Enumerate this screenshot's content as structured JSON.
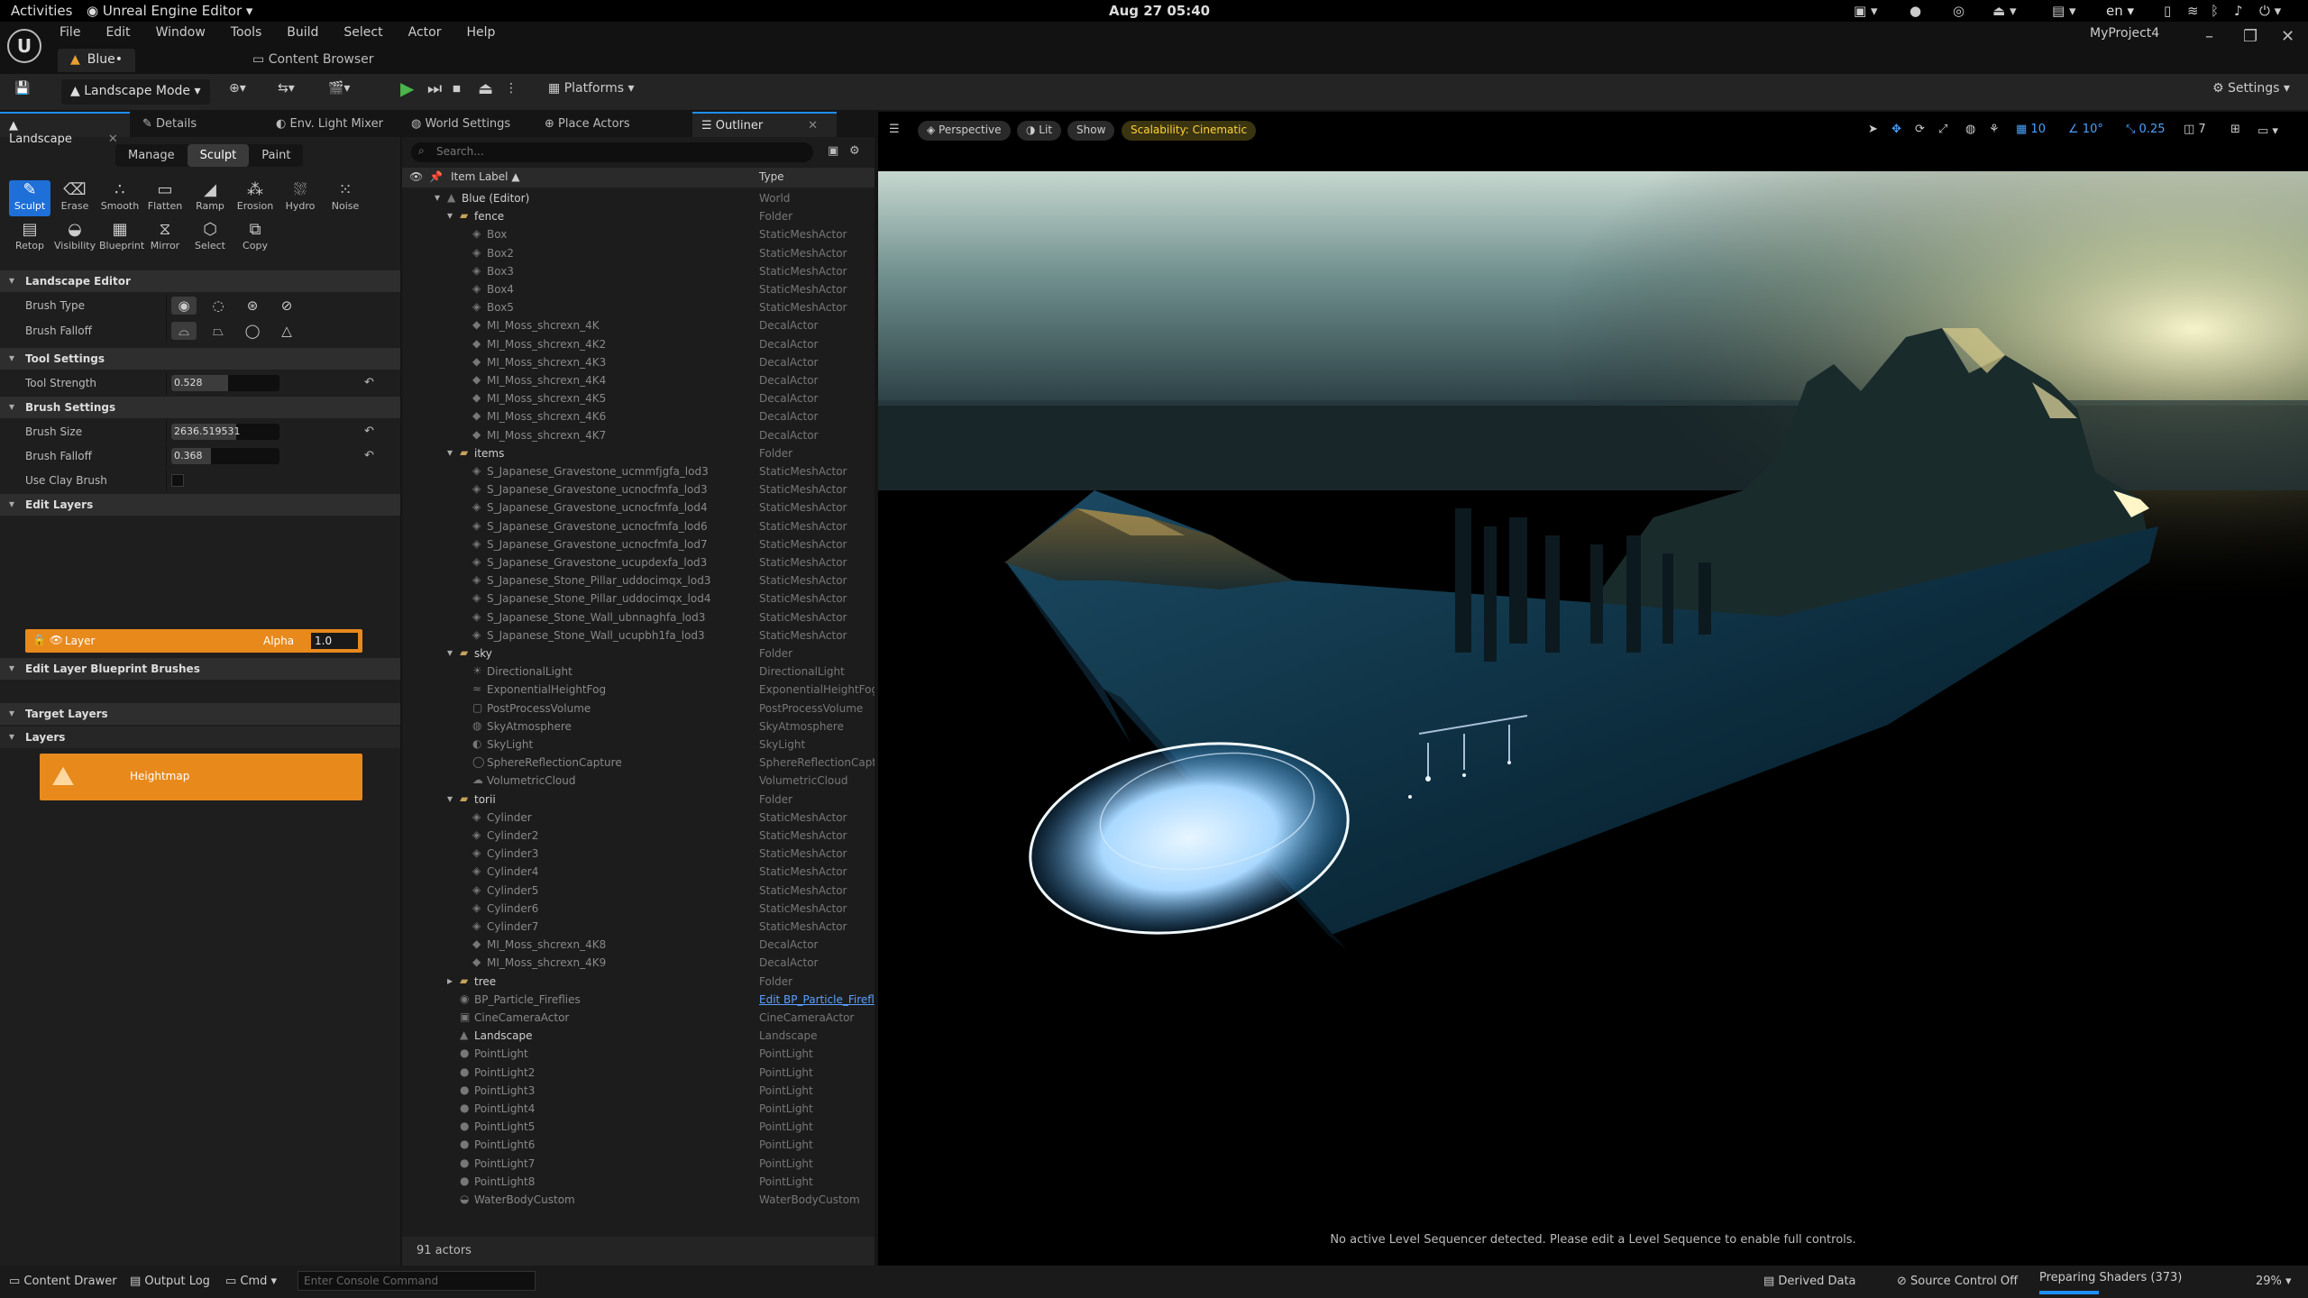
{
  "system_bar": {
    "activities": "Activities",
    "app_name": "Unreal Engine Editor",
    "clock": "Aug 27  05:40",
    "language": "en"
  },
  "editor": {
    "menu": [
      "File",
      "Edit",
      "Window",
      "Tools",
      "Build",
      "Select",
      "Actor",
      "Help"
    ],
    "project": "MyProject4",
    "level_tab": "Blue•",
    "content_browser_tab": "Content Browser"
  },
  "toolbar": {
    "mode": "Landscape Mode",
    "platforms": "Platforms",
    "settings": "Settings"
  },
  "left_panel": {
    "tabs": [
      "Landscape",
      "Details",
      "Env. Light Mixer"
    ],
    "modes": [
      "Manage",
      "Sculpt",
      "Paint"
    ],
    "tools_row1": [
      "Sculpt",
      "Erase",
      "Smooth",
      "Flatten",
      "Ramp",
      "Erosion",
      "Hydro",
      "Noise"
    ],
    "tools_row2": [
      "Retop",
      "Visibility",
      "Blueprint",
      "Mirror",
      "Select",
      "Copy"
    ],
    "sections": {
      "landscape_editor": "Landscape Editor",
      "tool_settings": "Tool Settings",
      "brush_settings": "Brush Settings",
      "edit_layers": "Edit Layers",
      "edit_layer_bp": "Edit Layer Blueprint Brushes",
      "target_layers": "Target Layers",
      "layers": "Layers"
    },
    "brush_type_label": "Brush Type",
    "brush_falloff_type_label": "Brush Falloff",
    "tool_strength_label": "Tool Strength",
    "tool_strength": "0.528",
    "tool_strength_fraction": 0.528,
    "brush_size_label": "Brush Size",
    "brush_size": "2636.519531",
    "brush_size_fraction": 0.6,
    "brush_falloff_label": "Brush Falloff",
    "brush_falloff": "0.368",
    "brush_falloff_fraction": 0.368,
    "use_clay_brush_label": "Use Clay Brush",
    "layer_name": "Layer",
    "alpha_label": "Alpha",
    "alpha_value": "1.0",
    "heightmap": "Heightmap"
  },
  "outliner": {
    "tabs": [
      "World Settings",
      "Place Actors",
      "Outliner"
    ],
    "search_placeholder": "Search...",
    "col_label": "Item Label ▲",
    "col_type": "Type",
    "rows": [
      {
        "name": "Blue (Editor)",
        "type": "World",
        "level": 0,
        "icon": "world-icon",
        "caret": "▾",
        "bright": true
      },
      {
        "name": "fence",
        "type": "Folder",
        "level": 1,
        "icon": "folder-icon",
        "caret": "▾",
        "bright": true
      },
      {
        "name": "Box",
        "type": "StaticMeshActor",
        "level": 2,
        "icon": "mesh-icon"
      },
      {
        "name": "Box2",
        "type": "StaticMeshActor",
        "level": 2,
        "icon": "mesh-icon"
      },
      {
        "name": "Box3",
        "type": "StaticMeshActor",
        "level": 2,
        "icon": "mesh-icon"
      },
      {
        "name": "Box4",
        "type": "StaticMeshActor",
        "level": 2,
        "icon": "mesh-icon"
      },
      {
        "name": "Box5",
        "type": "StaticMeshActor",
        "level": 2,
        "icon": "mesh-icon"
      },
      {
        "name": "MI_Moss_shcrexn_4K",
        "type": "DecalActor",
        "level": 2,
        "icon": "decal-icon"
      },
      {
        "name": "MI_Moss_shcrexn_4K2",
        "type": "DecalActor",
        "level": 2,
        "icon": "decal-icon"
      },
      {
        "name": "MI_Moss_shcrexn_4K3",
        "type": "DecalActor",
        "level": 2,
        "icon": "decal-icon"
      },
      {
        "name": "MI_Moss_shcrexn_4K4",
        "type": "DecalActor",
        "level": 2,
        "icon": "decal-icon"
      },
      {
        "name": "MI_Moss_shcrexn_4K5",
        "type": "DecalActor",
        "level": 2,
        "icon": "decal-icon"
      },
      {
        "name": "MI_Moss_shcrexn_4K6",
        "type": "DecalActor",
        "level": 2,
        "icon": "decal-icon"
      },
      {
        "name": "MI_Moss_shcrexn_4K7",
        "type": "DecalActor",
        "level": 2,
        "icon": "decal-icon"
      },
      {
        "name": "items",
        "type": "Folder",
        "level": 1,
        "icon": "folder-icon",
        "caret": "▾",
        "bright": true
      },
      {
        "name": "S_Japanese_Gravestone_ucmmfjgfa_lod3",
        "type": "StaticMeshActor",
        "level": 2,
        "icon": "mesh-icon"
      },
      {
        "name": "S_Japanese_Gravestone_ucnocfmfa_lod3",
        "type": "StaticMeshActor",
        "level": 2,
        "icon": "mesh-icon"
      },
      {
        "name": "S_Japanese_Gravestone_ucnocfmfa_lod4",
        "type": "StaticMeshActor",
        "level": 2,
        "icon": "mesh-icon"
      },
      {
        "name": "S_Japanese_Gravestone_ucnocfmfa_lod6",
        "type": "StaticMeshActor",
        "level": 2,
        "icon": "mesh-icon"
      },
      {
        "name": "S_Japanese_Gravestone_ucnocfmfa_lod7",
        "type": "StaticMeshActor",
        "level": 2,
        "icon": "mesh-icon"
      },
      {
        "name": "S_Japanese_Gravestone_ucupdexfa_lod3",
        "type": "StaticMeshActor",
        "level": 2,
        "icon": "mesh-icon"
      },
      {
        "name": "S_Japanese_Stone_Pillar_uddocimqx_lod3",
        "type": "StaticMeshActor",
        "level": 2,
        "icon": "mesh-icon"
      },
      {
        "name": "S_Japanese_Stone_Pillar_uddocimqx_lod4",
        "type": "StaticMeshActor",
        "level": 2,
        "icon": "mesh-icon"
      },
      {
        "name": "S_Japanese_Stone_Wall_ubnnaghfa_lod3",
        "type": "StaticMeshActor",
        "level": 2,
        "icon": "mesh-icon"
      },
      {
        "name": "S_Japanese_Stone_Wall_ucupbh1fa_lod3",
        "type": "StaticMeshActor",
        "level": 2,
        "icon": "mesh-icon"
      },
      {
        "name": "sky",
        "type": "Folder",
        "level": 1,
        "icon": "folder-icon",
        "caret": "▾",
        "bright": true
      },
      {
        "name": "DirectionalLight",
        "type": "DirectionalLight",
        "level": 2,
        "icon": "sun-icon"
      },
      {
        "name": "ExponentialHeightFog",
        "type": "ExponentialHeightFog",
        "level": 2,
        "icon": "fog-icon"
      },
      {
        "name": "PostProcessVolume",
        "type": "PostProcessVolume",
        "level": 2,
        "icon": "volume-icon"
      },
      {
        "name": "SkyAtmosphere",
        "type": "SkyAtmosphere",
        "level": 2,
        "icon": "sky-icon"
      },
      {
        "name": "SkyLight",
        "type": "SkyLight",
        "level": 2,
        "icon": "skylight-icon"
      },
      {
        "name": "SphereReflectionCapture",
        "type": "SphereReflectionCapture",
        "level": 2,
        "icon": "sphere-icon"
      },
      {
        "name": "VolumetricCloud",
        "type": "VolumetricCloud",
        "level": 2,
        "icon": "cloud-icon"
      },
      {
        "name": "torii",
        "type": "Folder",
        "level": 1,
        "icon": "folder-icon",
        "caret": "▾",
        "bright": true
      },
      {
        "name": "Cylinder",
        "type": "StaticMeshActor",
        "level": 2,
        "icon": "mesh-icon"
      },
      {
        "name": "Cylinder2",
        "type": "StaticMeshActor",
        "level": 2,
        "icon": "mesh-icon"
      },
      {
        "name": "Cylinder3",
        "type": "StaticMeshActor",
        "level": 2,
        "icon": "mesh-icon"
      },
      {
        "name": "Cylinder4",
        "type": "StaticMeshActor",
        "level": 2,
        "icon": "mesh-icon"
      },
      {
        "name": "Cylinder5",
        "type": "StaticMeshActor",
        "level": 2,
        "icon": "mesh-icon"
      },
      {
        "name": "Cylinder6",
        "type": "StaticMeshActor",
        "level": 2,
        "icon": "mesh-icon"
      },
      {
        "name": "Cylinder7",
        "type": "StaticMeshActor",
        "level": 2,
        "icon": "mesh-icon"
      },
      {
        "name": "MI_Moss_shcrexn_4K8",
        "type": "DecalActor",
        "level": 2,
        "icon": "decal-icon"
      },
      {
        "name": "MI_Moss_shcrexn_4K9",
        "type": "DecalActor",
        "level": 2,
        "icon": "decal-icon"
      },
      {
        "name": "tree",
        "type": "Folder",
        "level": 1,
        "icon": "folder-icon",
        "caret": "▸",
        "bright": true
      },
      {
        "name": "BP_Particle_Fireflies",
        "type": "Edit BP_Particle_Firefl",
        "level": 1,
        "icon": "blueprint-icon",
        "link": true
      },
      {
        "name": "CineCameraActor",
        "type": "CineCameraActor",
        "level": 1,
        "icon": "camera-icon"
      },
      {
        "name": "Landscape",
        "type": "Landscape",
        "level": 1,
        "icon": "landscape-icon",
        "bright": true
      },
      {
        "name": "PointLight",
        "type": "PointLight",
        "level": 1,
        "icon": "pointlight-icon"
      },
      {
        "name": "PointLight2",
        "type": "PointLight",
        "level": 1,
        "icon": "pointlight-icon"
      },
      {
        "name": "PointLight3",
        "type": "PointLight",
        "level": 1,
        "icon": "pointlight-icon"
      },
      {
        "name": "PointLight4",
        "type": "PointLight",
        "level": 1,
        "icon": "pointlight-icon"
      },
      {
        "name": "PointLight5",
        "type": "PointLight",
        "level": 1,
        "icon": "pointlight-icon"
      },
      {
        "name": "PointLight6",
        "type": "PointLight",
        "level": 1,
        "icon": "pointlight-icon"
      },
      {
        "name": "PointLight7",
        "type": "PointLight",
        "level": 1,
        "icon": "pointlight-icon"
      },
      {
        "name": "PointLight8",
        "type": "PointLight",
        "level": 1,
        "icon": "pointlight-icon"
      },
      {
        "name": "WaterBodyCustom",
        "type": "WaterBodyCustom",
        "level": 1,
        "icon": "water-icon"
      }
    ],
    "footer": "91 actors"
  },
  "viewport": {
    "perspective": "Perspective",
    "lit": "Lit",
    "show": "Show",
    "scalability": "Scalability: Cinematic",
    "grid_snap": "10",
    "angle_snap": "10°",
    "scale_snap": "0.25",
    "camera_speed": "7",
    "sequencer_msg": "No active Level Sequencer detected. Please edit a Level Sequence to enable full controls."
  },
  "statusbar": {
    "content_drawer": "Content Drawer",
    "output_log": "Output Log",
    "cmd": "Cmd",
    "console_placeholder": "Enter Console Command",
    "derived_data": "Derived Data",
    "source_control": "Source Control Off",
    "shaders": "Preparing Shaders (373)",
    "zoom": "29%"
  },
  "colors": {
    "accent": "#1e8fff",
    "layer_orange": "#e8891c",
    "play_green": "#4ab54a"
  }
}
